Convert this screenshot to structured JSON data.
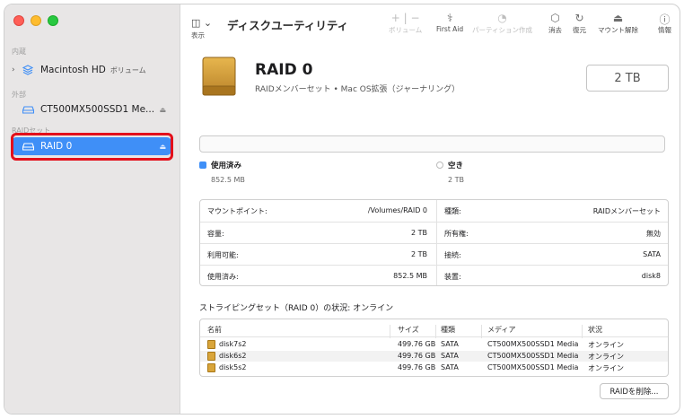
{
  "window": {
    "title": "ディスクユーティリティ"
  },
  "toolbar": {
    "view_label": "表示",
    "add_remove_label": "ボリューム",
    "first_aid_label": "First Aid",
    "partition_label": "パーティション作成",
    "erase_label": "消去",
    "restore_label": "復元",
    "unmount_label": "マウント解除",
    "info_label": "情報"
  },
  "sidebar": {
    "sections": [
      {
        "label": "内蔵",
        "items": [
          {
            "label": "Macintosh HD",
            "sub": "ボリューム",
            "icon": "stack-icon"
          }
        ]
      },
      {
        "label": "外部",
        "items": [
          {
            "label": "CT500MX500SSD1 Me...",
            "icon": "external-drive-icon"
          }
        ]
      },
      {
        "label": "RAIDセット",
        "items": [
          {
            "label": "RAID 0",
            "icon": "external-drive-icon",
            "selected": true
          }
        ]
      }
    ]
  },
  "disk": {
    "name": "RAID 0",
    "description": "RAIDメンバーセット • Mac OS拡張（ジャーナリング）",
    "capacity": "2 TB"
  },
  "usage": {
    "used_label": "使用済み",
    "used_value": "852.5 MB",
    "free_label": "空き",
    "free_value": "2 TB",
    "used_color": "#3f8ff7",
    "used_fraction": 0.0004
  },
  "info_rows": [
    {
      "l_label": "マウントポイント:",
      "l_value": "/Volumes/RAID 0",
      "r_label": "種類:",
      "r_value": "RAIDメンバーセット"
    },
    {
      "l_label": "容量:",
      "l_value": "2 TB",
      "r_label": "所有権:",
      "r_value": "無効"
    },
    {
      "l_label": "利用可能:",
      "l_value": "2 TB",
      "r_label": "接続:",
      "r_value": "SATA"
    },
    {
      "l_label": "使用済み:",
      "l_value": "852.5 MB",
      "r_label": "装置:",
      "r_value": "disk8"
    }
  ],
  "stripe_status": "ストライピングセット（RAID 0）の状況: オンライン",
  "members": {
    "headers": [
      "名前",
      "サイズ",
      "種類",
      "メディア",
      "状況"
    ],
    "rows": [
      {
        "name": "disk7s2",
        "size": "499.76 GB",
        "type": "SATA",
        "media": "CT500MX500SSD1 Media",
        "status": "オンライン"
      },
      {
        "name": "disk6s2",
        "size": "499.76 GB",
        "type": "SATA",
        "media": "CT500MX500SSD1 Media",
        "status": "オンライン"
      },
      {
        "name": "disk5s2",
        "size": "499.76 GB",
        "type": "SATA",
        "media": "CT500MX500SSD1 Media",
        "status": "オンライン"
      }
    ]
  },
  "delete_raid_label": "RAIDを削除..."
}
